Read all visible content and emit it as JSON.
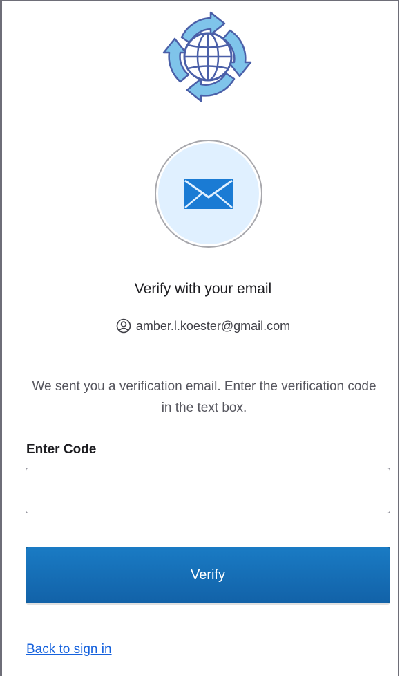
{
  "logo": {
    "icon": "globe-refresh-logo"
  },
  "authenticator": {
    "icon": "envelope-icon"
  },
  "title": "Verify with your email",
  "identifier": {
    "icon": "user-circle-icon",
    "email": "amber.l.koester@gmail.com"
  },
  "instructions": "We sent you a verification email. Enter the verification code in the text box.",
  "code_field": {
    "label": "Enter Code",
    "value": "",
    "placeholder": ""
  },
  "verify_button": {
    "label": "Verify"
  },
  "back_link": {
    "label": "Back to sign in"
  },
  "colors": {
    "primary_button": "#1662dd",
    "link": "#1662dd",
    "badge_fill": "#e0f0ff",
    "envelope": "#1a7bd4"
  }
}
